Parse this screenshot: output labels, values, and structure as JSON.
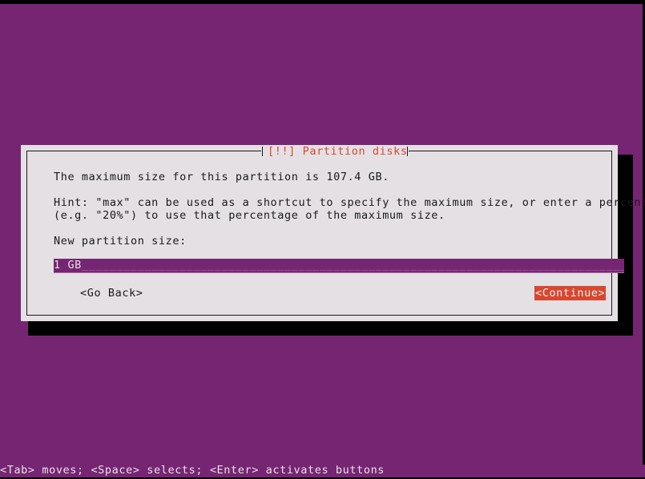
{
  "screen": {
    "background_color": "#762572",
    "shadow_color": "#000000"
  },
  "dialog": {
    "title": "[!!] Partition disks",
    "title_color": "#d6482f",
    "background_color": "#e4e0e4",
    "border_color": "#1a1a1a",
    "lines": {
      "max_size": "The maximum size for this partition is 107.4 GB.",
      "hint_line_1": "Hint: \"max\" can be used as a shortcut to specify the maximum size, or enter a percentage",
      "hint_line_2": "(e.g. \"20%\") to use that percentage of the maximum size.",
      "field_label": "New partition size:"
    },
    "input": {
      "value": "1 GB",
      "fill": "________________________________________________________________________________________",
      "background_color": "#762572",
      "text_color": "#e4e0e4"
    },
    "buttons": {
      "go_back": "<Go Back>",
      "continue": "<Continue>",
      "continue_highlight_color": "#d6482f",
      "continue_text_color": "#f2eef2"
    }
  },
  "status_bar": {
    "text": "<Tab> moves; <Space> selects; <Enter> activates buttons",
    "text_color": "#e8e2e8"
  }
}
